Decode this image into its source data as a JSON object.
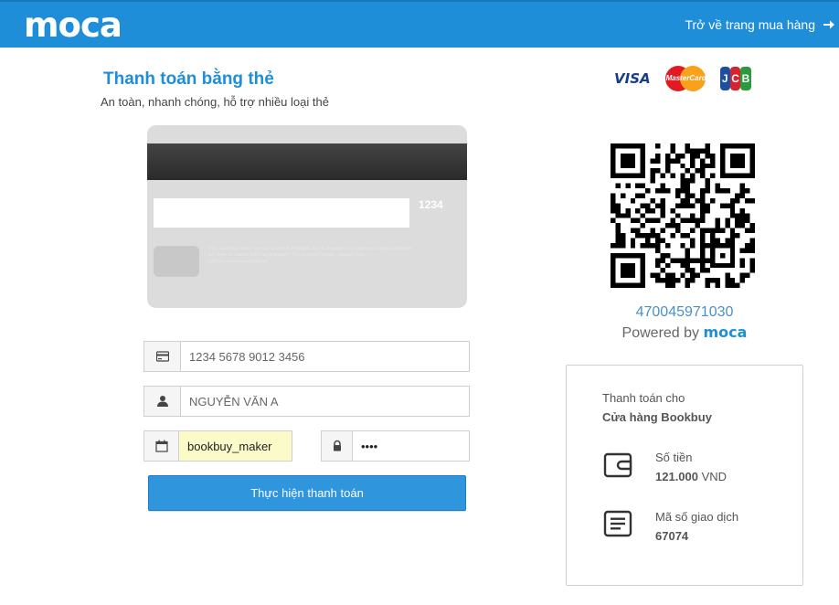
{
  "header": {
    "logo": "moca",
    "back_link": "Trở về trang mua hàng"
  },
  "page": {
    "title": "Thanh toán bằng thẻ",
    "subtitle": "An toàn, nhanh chóng, hỗ trợ nhiều loại thẻ"
  },
  "card_logos": {
    "visa": "VISA",
    "mastercard": "MasterCard",
    "jcb": [
      "J",
      "C",
      "B"
    ]
  },
  "card_back": {
    "cvv": "1234",
    "fine_print": "This card has been issued by Moca PolBank and is licensed for anyone to use anywhere for free. It comes with no warranty. For support issues, please visit: github.com/moca/polbank"
  },
  "form": {
    "card_number_placeholder": "1234 5678 9012 3456",
    "name_placeholder": "NGUYỄN VĂN A",
    "expiry_value": "bookbuy_maker",
    "password_value": "••••",
    "submit_label": "Thực hiện thanh toán"
  },
  "qr": {
    "code": "470045971030",
    "powered_prefix": "Powered by ",
    "powered_brand": "moca"
  },
  "order": {
    "pay_to_label": "Thanh toán cho",
    "merchant": "Cửa hàng Bookbuy",
    "amount_label": "Số tiền",
    "amount_value": "121.000",
    "currency": "VND",
    "txn_label": "Mã số giao dịch",
    "txn_value": "67074"
  },
  "colors": {
    "brand_blue": "#1e8ed8",
    "button_blue": "#2f95dd",
    "autofill_yellow": "#fafbc8"
  },
  "icons": {
    "card_number": "credit-card-icon",
    "name": "user-icon",
    "expiry": "calendar-icon",
    "password": "lock-icon",
    "back": "arrow-right-icon",
    "amount": "wallet-icon",
    "transaction": "receipt-icon"
  }
}
